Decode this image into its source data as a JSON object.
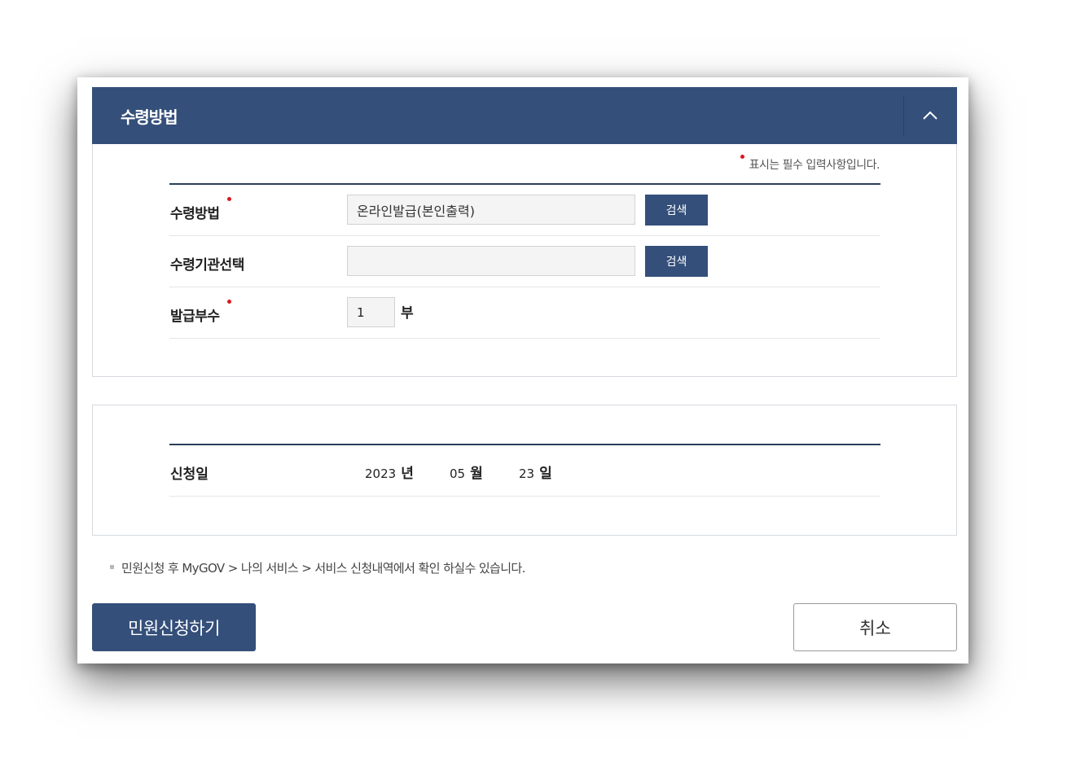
{
  "section_receive": {
    "title": "수령방법",
    "required_note": "표시는 필수 입력사항입니다.",
    "rows": {
      "method": {
        "label": "수령방법",
        "value": "온라인발급(본인출력)",
        "button": "검색",
        "required": true
      },
      "agency": {
        "label": "수령기관선택",
        "value": "",
        "button": "검색",
        "required": false
      },
      "copies": {
        "label": "발급부수",
        "value": "1",
        "unit": "부",
        "required": true
      }
    }
  },
  "section_date": {
    "label": "신청일",
    "year": "2023",
    "year_unit": "년",
    "month": "05",
    "month_unit": "월",
    "day": "23",
    "day_unit": "일"
  },
  "notice": "민원신청 후 MyGOV > 나의 서비스 > 서비스 신청내역에서 확인 하실수 있습니다.",
  "actions": {
    "apply": "민원신청하기",
    "cancel": "취소"
  },
  "colors": {
    "primary": "#344f7a",
    "required_dot": "#e0161d"
  },
  "icons": {
    "collapse": "chevron-up-icon"
  }
}
